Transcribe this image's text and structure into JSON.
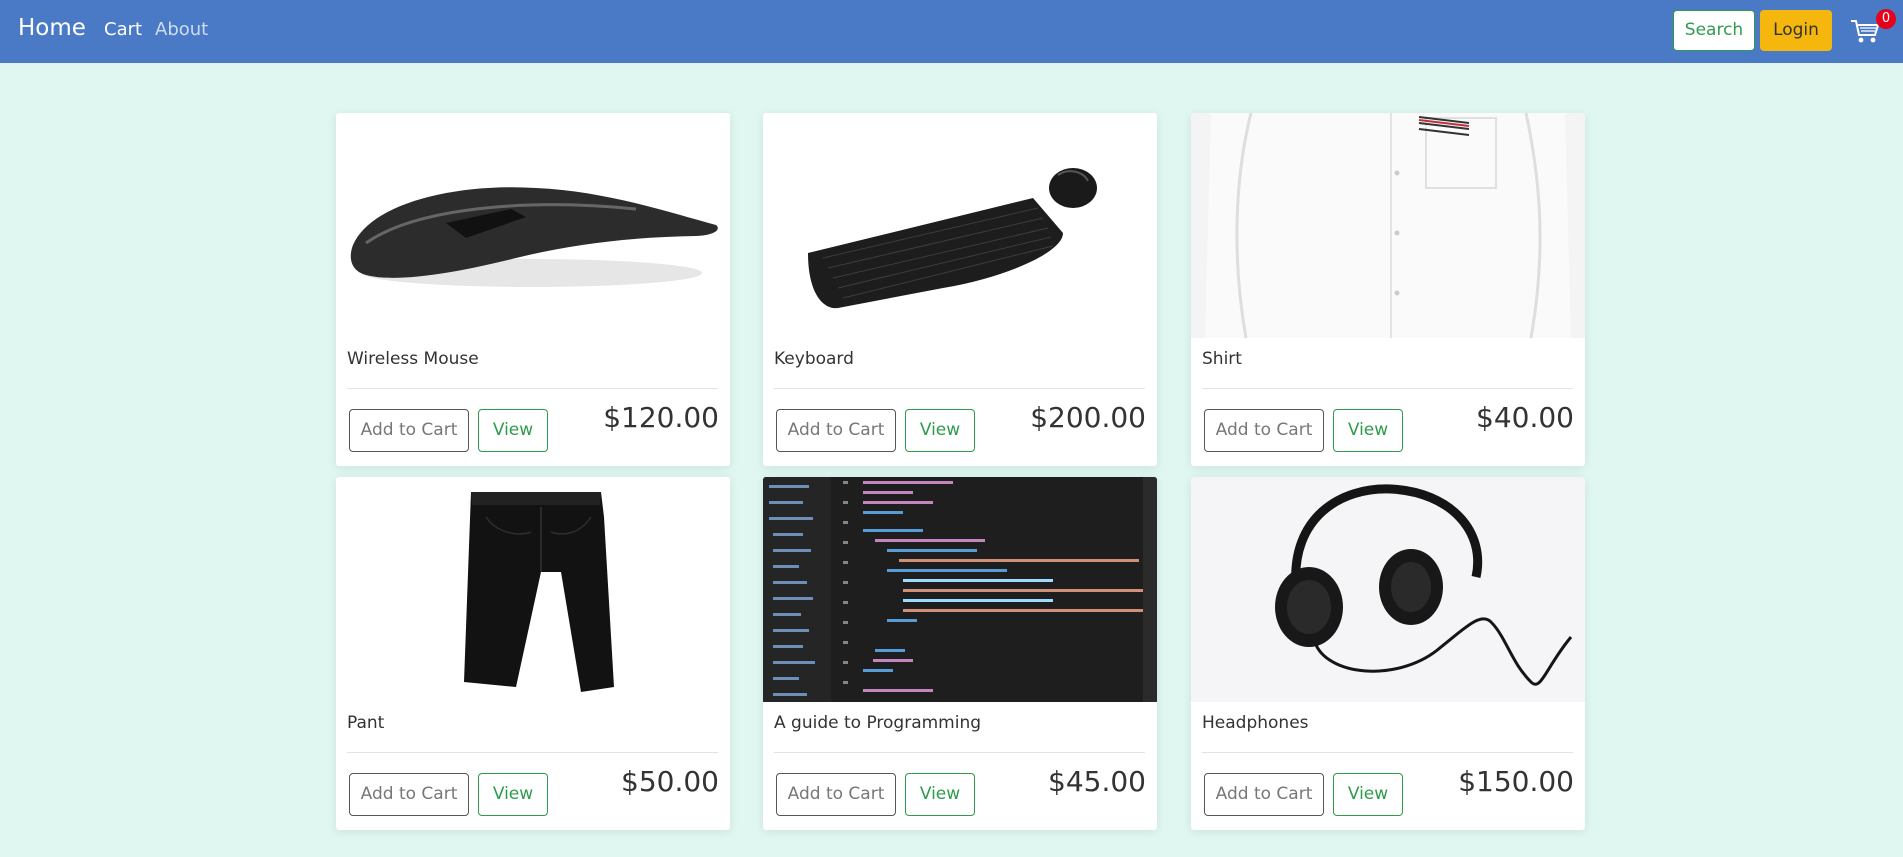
{
  "navbar": {
    "brand": "Home",
    "links": [
      "Cart",
      "About"
    ],
    "search_label": "Search",
    "login_label": "Login",
    "cart_count": "0",
    "colors": {
      "bar": "#4a7ac5",
      "login": "#f5b70e",
      "search": "#2f9b4c",
      "badge": "#e5001b"
    }
  },
  "products": [
    {
      "name": "Wireless Mouse",
      "price": "$120.00",
      "add_label": "Add to Cart",
      "view_label": "View",
      "image": "wireless-mouse-photo"
    },
    {
      "name": "Keyboard",
      "price": "$200.00",
      "add_label": "Add to Cart",
      "view_label": "View",
      "image": "keyboard-and-mouse-photo"
    },
    {
      "name": "Shirt",
      "price": "$40.00",
      "add_label": "Add to Cart",
      "view_label": "View",
      "image": "white-shirt-photo"
    },
    {
      "name": "Pant",
      "price": "$50.00",
      "add_label": "Add to Cart",
      "view_label": "View",
      "image": "black-pants-photo"
    },
    {
      "name": "A guide to Programming",
      "price": "$45.00",
      "add_label": "Add to Cart",
      "view_label": "View",
      "image": "code-editor-screenshot"
    },
    {
      "name": "Headphones",
      "price": "$150.00",
      "add_label": "Add to Cart",
      "view_label": "View",
      "image": "headphones-photo"
    }
  ],
  "background_color": "#e0f7f1"
}
